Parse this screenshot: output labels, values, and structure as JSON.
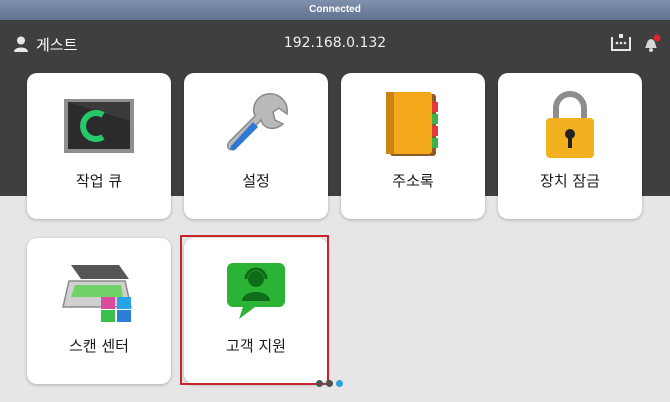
{
  "status_bar": {
    "text": "Connected"
  },
  "header": {
    "user_name": "게스트",
    "ip_address": "192.168.0.132"
  },
  "tiles": [
    {
      "label": "작업 큐",
      "icon": "monitor-icon"
    },
    {
      "label": "설정",
      "icon": "wrench-icon"
    },
    {
      "label": "주소록",
      "icon": "address-book-icon"
    },
    {
      "label": "장치 잠금",
      "icon": "padlock-icon"
    },
    {
      "label": "스캔 센터",
      "icon": "scanner-icon"
    },
    {
      "label": "고객 지원",
      "icon": "customer-support-icon"
    }
  ],
  "pagination": {
    "pages": 3,
    "active_index": 2
  },
  "colors": {
    "header": "#3f3f3f",
    "status_bar": "#6f8199",
    "highlight": "#c8262c",
    "active_dot": "#2d9fd8"
  }
}
